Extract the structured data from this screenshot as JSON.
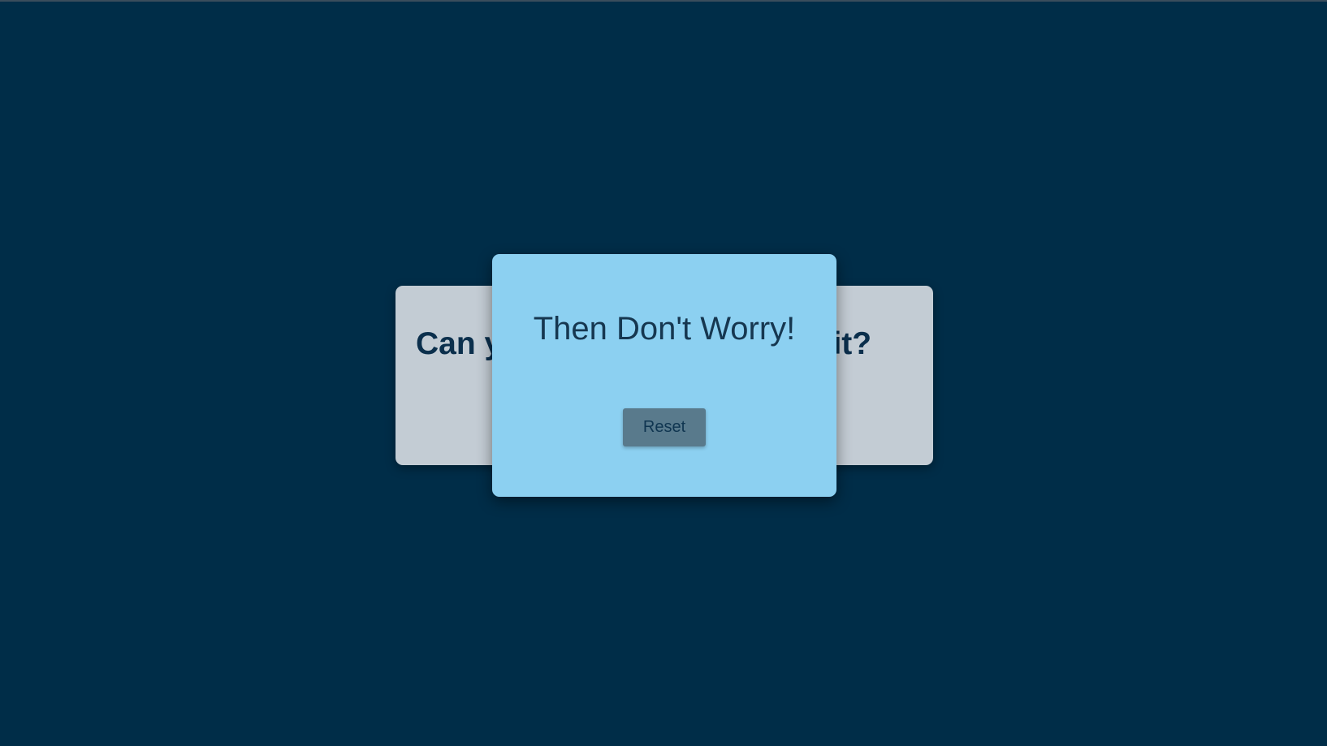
{
  "background_color": "#002d48",
  "back_card": {
    "question": "Can you do anything about it?",
    "color": "#c3ccd4"
  },
  "front_card": {
    "heading": "Then Don't Worry!",
    "button_label": "Reset",
    "color": "#8cd0f1"
  }
}
